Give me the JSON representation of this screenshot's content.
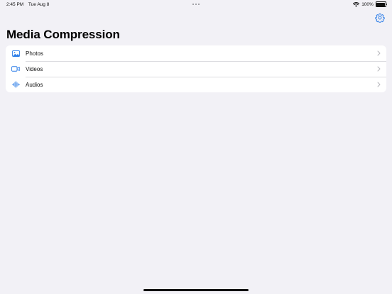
{
  "status_bar": {
    "time": "2:45 PM",
    "date": "Tue Aug 8",
    "battery": "100%"
  },
  "page": {
    "title": "Media Compression"
  },
  "media_list": {
    "items": [
      {
        "label": "Photos",
        "icon": "photo-icon"
      },
      {
        "label": "Videos",
        "icon": "video-camera-icon"
      },
      {
        "label": "Audios",
        "icon": "waveform-icon"
      }
    ]
  },
  "colors": {
    "accent": "#2f7fe8",
    "background": "#f2f1f6",
    "card": "#ffffff",
    "chevron": "#b3b3b8"
  },
  "icons": {
    "settings": "gear-icon",
    "wifi": "wifi-icon",
    "battery": "battery-icon",
    "chevron": "chevron-right-icon"
  }
}
